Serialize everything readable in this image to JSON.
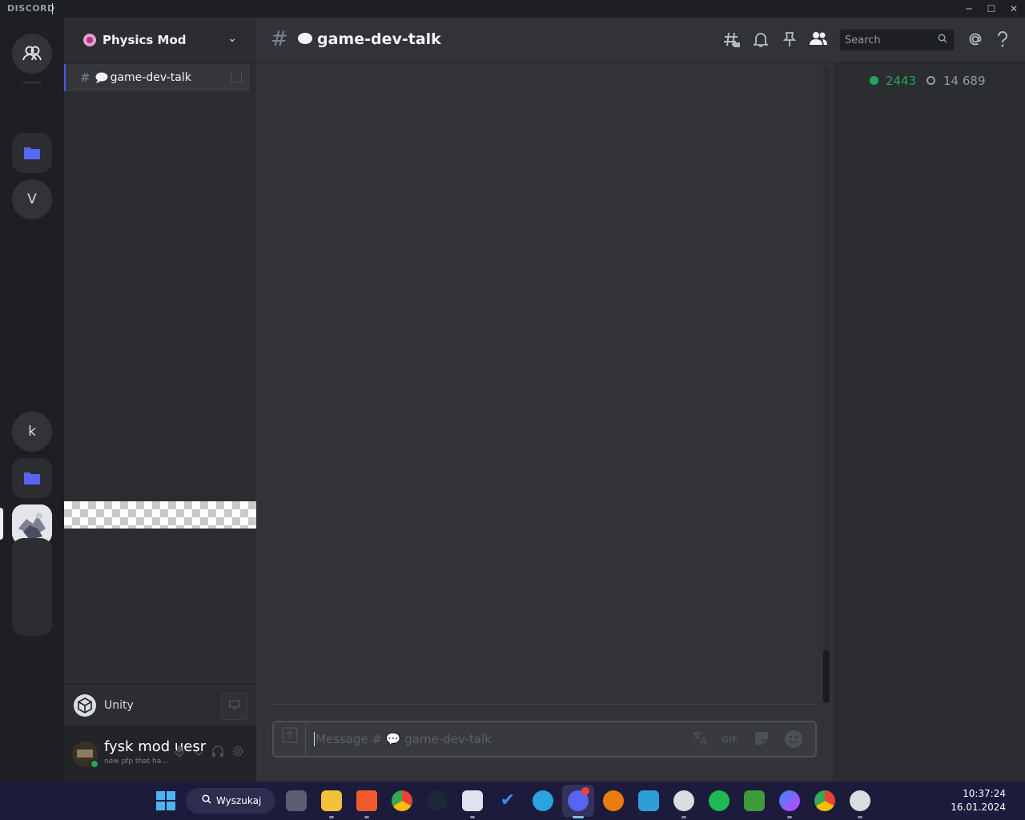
{
  "app": {
    "title": "DISCORD"
  },
  "window": {
    "minimize": "─",
    "maximize": "☐",
    "close": "✕"
  },
  "rail": {
    "servers": [
      {
        "name": "direct-messages",
        "icon": "people-icon"
      },
      {
        "name": "folder-1",
        "icon": "folder-icon"
      },
      {
        "name": "server-v",
        "label": "V"
      },
      {
        "name": "server-k",
        "label": "k"
      },
      {
        "name": "folder-2",
        "icon": "folder-icon"
      },
      {
        "name": "physics-mod",
        "icon": "server-avatar"
      }
    ]
  },
  "guild": {
    "name": "Physics Mod",
    "chevron": "⌄"
  },
  "channels": [
    {
      "hash": "#",
      "name": "game-dev-talk"
    }
  ],
  "activity": {
    "label": "Unity"
  },
  "user": {
    "name": "fysk mod uesr",
    "status_text": "new pfp that ha...",
    "status": "online"
  },
  "chat": {
    "channel_hash": "#",
    "channel_title": "game-dev-talk",
    "search_placeholder": "Search",
    "message_placeholder": "Message # 💬 game-dev-talk",
    "gif_label": "GIF"
  },
  "members": {
    "online": "2443",
    "total": "14 689"
  },
  "taskbar": {
    "search_label": "Wyszukaj",
    "time": "10:37:24",
    "date": "16.01.2024",
    "apps": [
      "task-view",
      "file-explorer",
      "brave",
      "chrome",
      "steam",
      "paint",
      "todo",
      "telegram",
      "discord",
      "blender",
      "notion",
      "unity-hub",
      "spotify",
      "minecraft",
      "messenger",
      "chrome-2",
      "unity"
    ]
  },
  "colors": {
    "accent": "#5865f2",
    "online": "#23a55a",
    "taskbar": "#1c1b3c"
  }
}
